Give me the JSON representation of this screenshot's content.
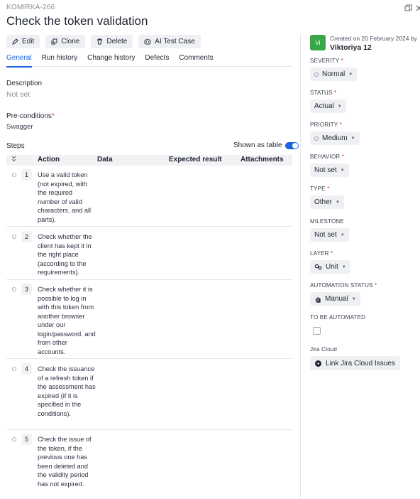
{
  "case_key": "KOMIRKA-266",
  "title": "Check the token validation",
  "toolbar": {
    "edit": "Edit",
    "clone": "Clone",
    "delete": "Delete",
    "ai_test_case": "AI Test Case"
  },
  "tabs": [
    "General",
    "Run history",
    "Change history",
    "Defects",
    "Comments"
  ],
  "active_tab": "General",
  "description": {
    "label": "Description",
    "value": "Not set"
  },
  "preconditions": {
    "label": "Pre-conditions",
    "required": "*",
    "value": "Swagger"
  },
  "steps": {
    "label": "Steps",
    "shown_as_table": "Shown as table",
    "columns": [
      "Action",
      "Data",
      "Expected result",
      "Attachments"
    ],
    "rows": [
      {
        "num": "1",
        "action": "Use a valid token (not expired, with the required number of valid characters, and all parts)."
      },
      {
        "num": "2",
        "action": "Check whether the client has kept it in the right place (according to the requirements)."
      },
      {
        "num": "3",
        "action": "Check whether it is possible to log in with this token from another browser under our login/password. and from other accounts."
      },
      {
        "num": "4",
        "action": "Check the issuance of a refresh token if the assessment has expired (if it is specified in the conditions)."
      },
      {
        "num": "5",
        "action": "Check the issue of the token, if the previous one has been deleted and the validity period has not expired."
      }
    ]
  },
  "meta": {
    "avatar_initials": "VI",
    "created": "Created on 20 February 2024 by",
    "author": "Viktoriya 12"
  },
  "fields": {
    "severity": {
      "label": "SEVERITY",
      "value": "Normal"
    },
    "status": {
      "label": "STATUS",
      "value": "Actual"
    },
    "priority": {
      "label": "PRIORITY",
      "value": "Medium"
    },
    "behavior": {
      "label": "BEHAVIOR",
      "value": "Not set"
    },
    "type": {
      "label": "TYPE",
      "value": "Other"
    },
    "milestone": {
      "label": "MILESTONE",
      "value": "Not set"
    },
    "layer": {
      "label": "LAYER",
      "value": "Unit"
    },
    "automation_status": {
      "label": "AUTOMATION STATUS",
      "value": "Manual"
    },
    "to_be_automated": {
      "label": "TO BE AUTOMATED"
    }
  },
  "jira": {
    "label": "Jira Cloud",
    "button": "Link Jira Cloud Issues"
  },
  "colors": {
    "accent": "#1b63e0",
    "avatar": "#3aa64a",
    "required": "#d32f2f"
  }
}
